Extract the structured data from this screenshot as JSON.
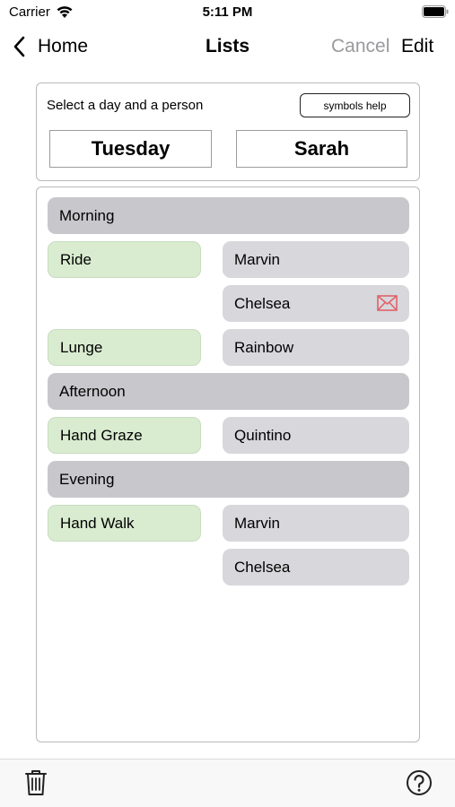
{
  "status_bar": {
    "carrier": "Carrier",
    "time": "5:11 PM"
  },
  "nav": {
    "back_label": "Home",
    "title": "Lists",
    "cancel_label": "Cancel",
    "edit_label": "Edit"
  },
  "selector": {
    "prompt": "Select a day and a person",
    "help_label": "symbols help",
    "day": "Tuesday",
    "person": "Sarah"
  },
  "schedule": {
    "morning": {
      "label": "Morning",
      "ride": {
        "task": "Ride",
        "horses": [
          "Marvin",
          "Chelsea"
        ]
      },
      "lunge": {
        "task": "Lunge",
        "horses": [
          "Rainbow"
        ]
      }
    },
    "afternoon": {
      "label": "Afternoon",
      "hand_graze": {
        "task": "Hand Graze",
        "horses": [
          "Quintino"
        ]
      }
    },
    "evening": {
      "label": "Evening",
      "hand_walk": {
        "task": "Hand Walk",
        "horses": [
          "Marvin",
          "Chelsea"
        ]
      }
    }
  },
  "icons": {
    "back": "chevron-left-icon",
    "mail": "envelope-icon",
    "trash": "trash-icon",
    "help": "question-circle-icon",
    "mail_color": "#e0626a",
    "task_color": "#d9ecd0",
    "horse_color": "#d7d7dc",
    "header_color": "#c7c7cc"
  }
}
